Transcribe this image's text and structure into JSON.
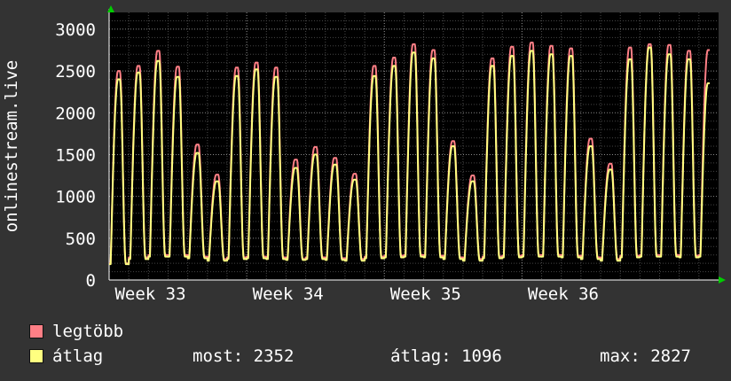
{
  "chart_data": {
    "type": "line",
    "ylabel": "onlinestream.live",
    "ylim": [
      0,
      3200
    ],
    "yticks": [
      0,
      500,
      1000,
      1500,
      2000,
      2500,
      3000
    ],
    "x_tick_labels": [
      "Week 33",
      "Week 34",
      "Week 35",
      "Week 36"
    ],
    "grid": true,
    "legend_position": "bottom",
    "days": 31,
    "series": [
      {
        "name": "legtöbb",
        "color": "#ff7f86",
        "daily_peak": [
          2500,
          2560,
          2740,
          2550,
          1620,
          1260,
          2540,
          2600,
          2540,
          1440,
          1590,
          1460,
          1270,
          2560,
          2660,
          2820,
          2750,
          1660,
          1250,
          2650,
          2790,
          2840,
          2800,
          2770,
          1690,
          1390,
          2780,
          2820,
          2810,
          2740,
          2750
        ],
        "daily_trough": [
          200,
          270,
          300,
          300,
          280,
          250,
          270,
          280,
          270,
          250,
          270,
          260,
          250,
          280,
          290,
          300,
          290,
          270,
          250,
          280,
          290,
          300,
          300,
          290,
          270,
          250,
          290,
          300,
          300,
          290,
          300
        ]
      },
      {
        "name": "átlag",
        "color": "#ffff80",
        "daily_peak": [
          2400,
          2480,
          2620,
          2430,
          1520,
          1180,
          2440,
          2520,
          2430,
          1340,
          1500,
          1380,
          1200,
          2440,
          2560,
          2720,
          2650,
          1600,
          1180,
          2560,
          2680,
          2740,
          2700,
          2680,
          1600,
          1320,
          2640,
          2780,
          2700,
          2640,
          2352
        ],
        "daily_trough": [
          190,
          250,
          280,
          280,
          260,
          230,
          250,
          260,
          250,
          240,
          250,
          240,
          230,
          260,
          270,
          280,
          270,
          250,
          230,
          260,
          270,
          280,
          280,
          270,
          250,
          230,
          270,
          280,
          280,
          270,
          280
        ]
      }
    ]
  },
  "legend": {
    "max_label": "legtöbb",
    "avg_label": "átlag",
    "now_text": "most: 2352",
    "avg_text": "átlag: 1096",
    "max_text": "max: 2827"
  },
  "colors": {
    "background": "#333333",
    "plot_background": "#000000",
    "grid": "#888888",
    "axis_arrow": "#00cc00"
  }
}
